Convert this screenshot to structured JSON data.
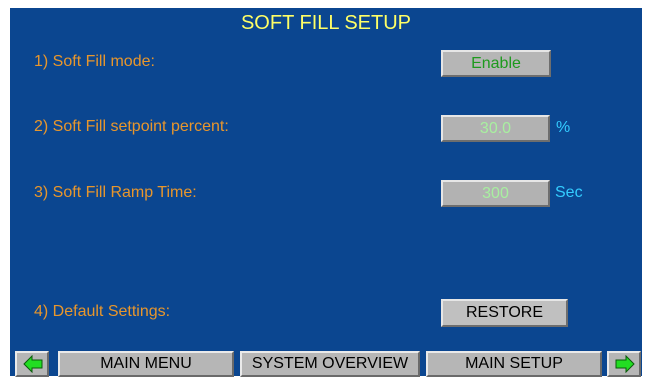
{
  "title": "SOFT FILL SETUP",
  "rows": [
    {
      "label": "1) Soft Fill mode:",
      "button": "Enable"
    },
    {
      "label": "2) Soft Fill setpoint percent:",
      "value": "30.0",
      "unit": "%"
    },
    {
      "label": "3) Soft Fill  Ramp Time:",
      "value": "300",
      "unit": "Sec"
    },
    {
      "label": "4) Default Settings:",
      "button": "RESTORE"
    }
  ],
  "nav": {
    "main_menu": "MAIN MENU",
    "system_overview": "SYSTEM OVERVIEW",
    "main_setup": "MAIN SETUP"
  },
  "icons": {
    "prev": "arrow-left-icon",
    "next": "arrow-right-icon"
  },
  "colors": {
    "background": "#0b4690",
    "title": "#ffff66",
    "label": "#e8962c",
    "unit": "#33ccff",
    "enable_text": "#1e9a1e",
    "field_text": "#a8f0a0",
    "arrow_green": "#22dd22"
  }
}
